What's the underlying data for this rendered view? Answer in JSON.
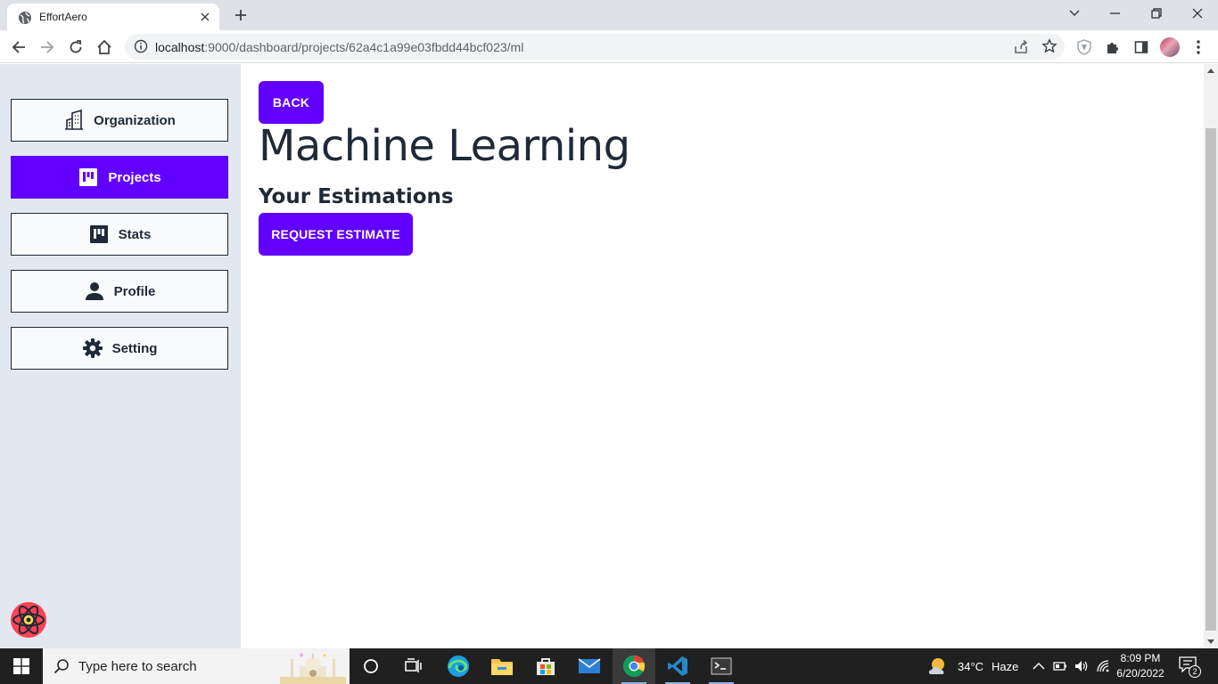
{
  "browser": {
    "tab_title": "EffortAero",
    "url_host": "localhost",
    "url_rest": ":9000/dashboard/projects/62a4c1a99e03fbdd44bcf023/ml"
  },
  "sidebar": {
    "items": [
      {
        "label": "Organization",
        "icon": "building-icon",
        "active": false
      },
      {
        "label": "Projects",
        "icon": "board-icon",
        "active": true
      },
      {
        "label": "Stats",
        "icon": "board-icon",
        "active": false
      },
      {
        "label": "Profile",
        "icon": "person-icon",
        "active": false
      },
      {
        "label": "Setting",
        "icon": "gear-icon",
        "active": false
      }
    ]
  },
  "main": {
    "back_label": "BACK",
    "title": "Machine Learning",
    "section_title": "Your Estimations",
    "request_label": "REQUEST ESTIMATE"
  },
  "taskbar": {
    "search_placeholder": "Type here to search",
    "weather_temp": "34°C",
    "weather_desc": "Haze",
    "time": "8:09 PM",
    "date": "6/20/2022",
    "notification_count": "2"
  },
  "colors": {
    "accent": "#6100ff",
    "sidebar_bg": "#e2e8f0",
    "text": "#1f2937"
  }
}
